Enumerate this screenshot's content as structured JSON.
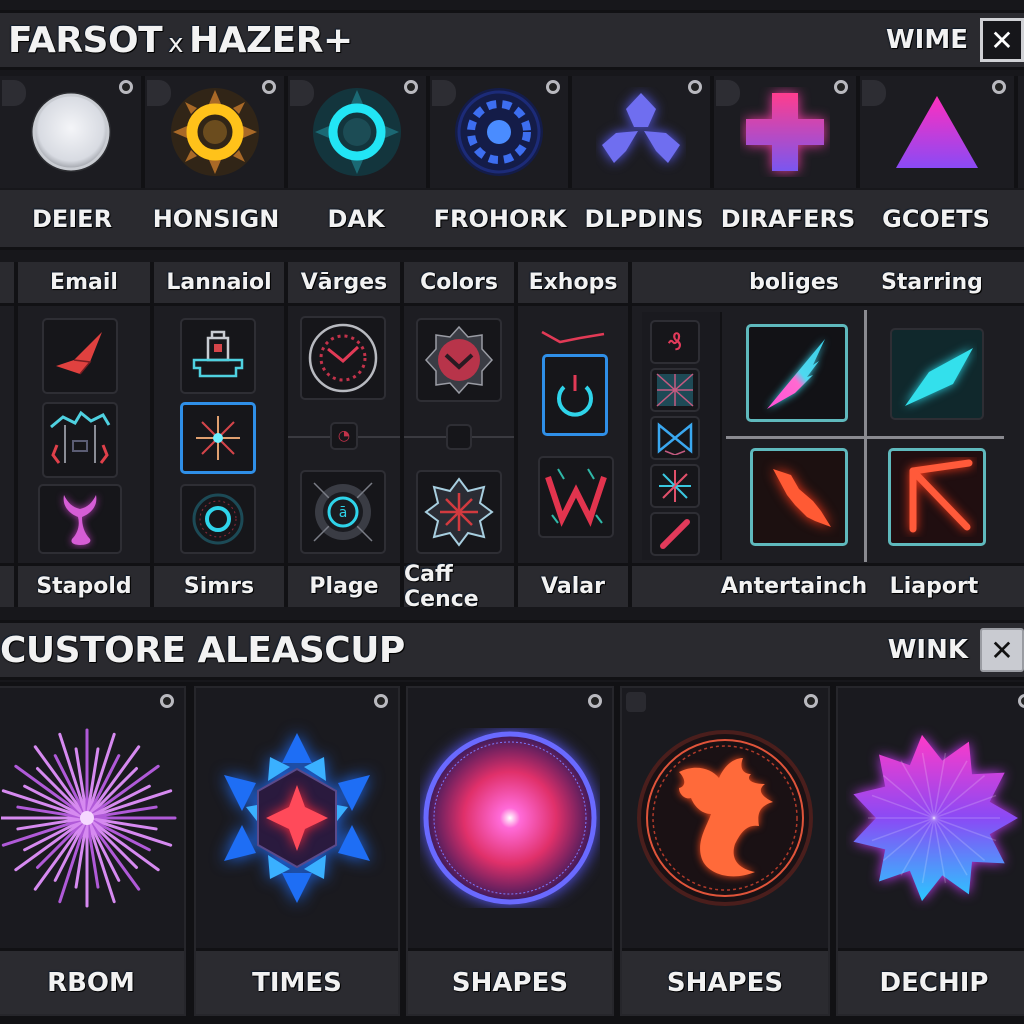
{
  "window1": {
    "title_left": "FARSOT",
    "title_sep": "x",
    "title_right": "HAZER+",
    "right_label": "WIME",
    "close_label": "✕"
  },
  "top_items": [
    {
      "label": "DEIER",
      "icon": "white-orb-icon"
    },
    {
      "label": "HONSIGN",
      "icon": "golden-ring-icon"
    },
    {
      "label": "DAK",
      "icon": "cyan-ring-icon"
    },
    {
      "label": "FROHORK",
      "icon": "blue-gear-orb-icon"
    },
    {
      "label": "DLPDINS",
      "icon": "tri-petal-icon"
    },
    {
      "label": "DIRAFERS",
      "icon": "dpad-cross-icon"
    },
    {
      "label": "GCOETS",
      "icon": "triangle-icon"
    }
  ],
  "mid_columns": [
    {
      "header": "Email",
      "footer": "Stapold",
      "icons": [
        "red-origami-icon",
        "arch-gate-icon",
        "pink-tree-icon"
      ]
    },
    {
      "header": "Lannaiol",
      "footer": "Simrs",
      "icons": [
        "lock-tray-icon",
        "spark-burst-icon",
        "cyan-ring-seal-icon"
      ],
      "selected": 1
    },
    {
      "header": "Vārges",
      "footer": "Plage",
      "icons": [
        "clock-icon",
        "small-red-glyph-icon",
        "cyan-rune-sun-icon"
      ]
    },
    {
      "header": "Colors",
      "footer": "Caff Cence",
      "icons": [
        "crimson-emblem-icon",
        "empty-slot-icon",
        "frost-star-icon"
      ]
    },
    {
      "header": "Exhops",
      "footer": "Valar",
      "icons": [
        "power-icon",
        "red-w-sigil-icon"
      ],
      "selected": 0
    }
  ],
  "mini_icons": [
    "red-rune-icon",
    "cross-grid-icon",
    "bowtie-icon",
    "snowflake-icon",
    "red-slash-icon"
  ],
  "quad": {
    "headers": [
      "boliges",
      "Starring"
    ],
    "footers": [
      "Antertainch",
      "Liaport"
    ],
    "icons": [
      "cyan-feather-blade-icon",
      "cyan-crystal-icon",
      "orange-arrow-fish-icon",
      "orange-rays-icon"
    ]
  },
  "window2": {
    "title": "CUSTORE ALEASCUP",
    "right_label": "WINK",
    "close_label": "✕"
  },
  "bottom_cards": [
    {
      "label": "RBOM",
      "icon": "violet-firework-icon"
    },
    {
      "label": "TIMES",
      "icon": "blue-snowflake-star-icon"
    },
    {
      "label": "SHAPES",
      "icon": "pink-nebula-orb-icon"
    },
    {
      "label": "SHAPES",
      "icon": "fire-dragon-seal-icon"
    },
    {
      "label": "DECHIP",
      "icon": "purple-bloom-icon"
    }
  ],
  "colors": {
    "accent_select": "#2f8fe8",
    "accent_teal": "#5fb9bd",
    "panel": "#2a2a2f",
    "background": "#17171b"
  }
}
